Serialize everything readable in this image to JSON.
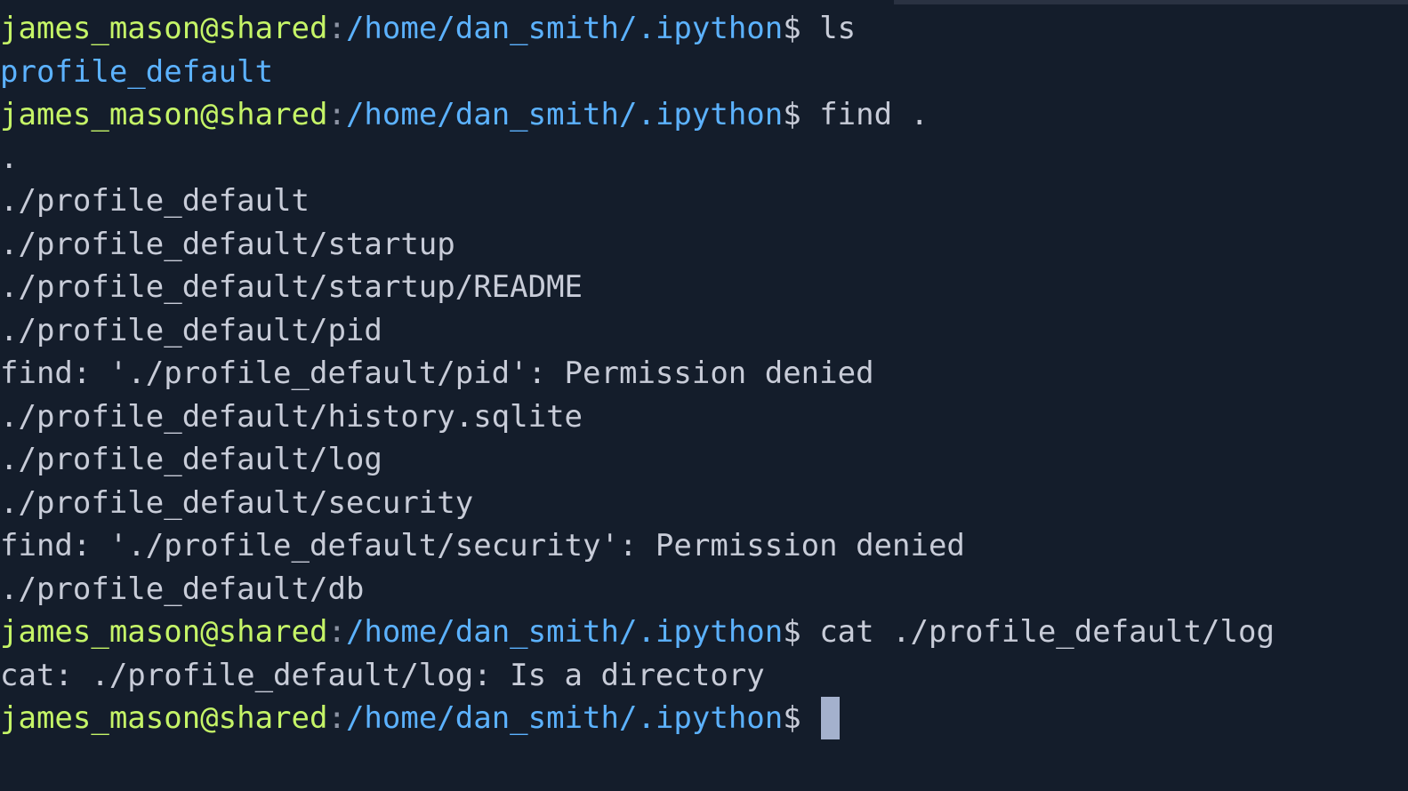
{
  "terminal": {
    "colors": {
      "background": "#141d2b",
      "user": "#c5f467",
      "path": "#5cb2ff",
      "text": "#c8ccd8",
      "cursor": "#a4b1cd"
    },
    "prompt": {
      "user_host": "james_mason@shared",
      "separator": ":",
      "path": "/home/dan_smith/.ipython",
      "symbol": "$ "
    },
    "lines": [
      {
        "type": "prompt",
        "command": "ls"
      },
      {
        "type": "output-dir",
        "text": "profile_default"
      },
      {
        "type": "prompt",
        "command": "find ."
      },
      {
        "type": "output",
        "text": "."
      },
      {
        "type": "output",
        "text": "./profile_default"
      },
      {
        "type": "output",
        "text": "./profile_default/startup"
      },
      {
        "type": "output",
        "text": "./profile_default/startup/README"
      },
      {
        "type": "output",
        "text": "./profile_default/pid"
      },
      {
        "type": "output",
        "text": "find: './profile_default/pid': Permission denied"
      },
      {
        "type": "output",
        "text": "./profile_default/history.sqlite"
      },
      {
        "type": "output",
        "text": "./profile_default/log"
      },
      {
        "type": "output",
        "text": "./profile_default/security"
      },
      {
        "type": "output",
        "text": "find: './profile_default/security': Permission denied"
      },
      {
        "type": "output",
        "text": "./profile_default/db"
      },
      {
        "type": "prompt",
        "command": "cat ./profile_default/log"
      },
      {
        "type": "output",
        "text": "cat: ./profile_default/log: Is a directory"
      },
      {
        "type": "prompt-active",
        "command": ""
      }
    ]
  }
}
